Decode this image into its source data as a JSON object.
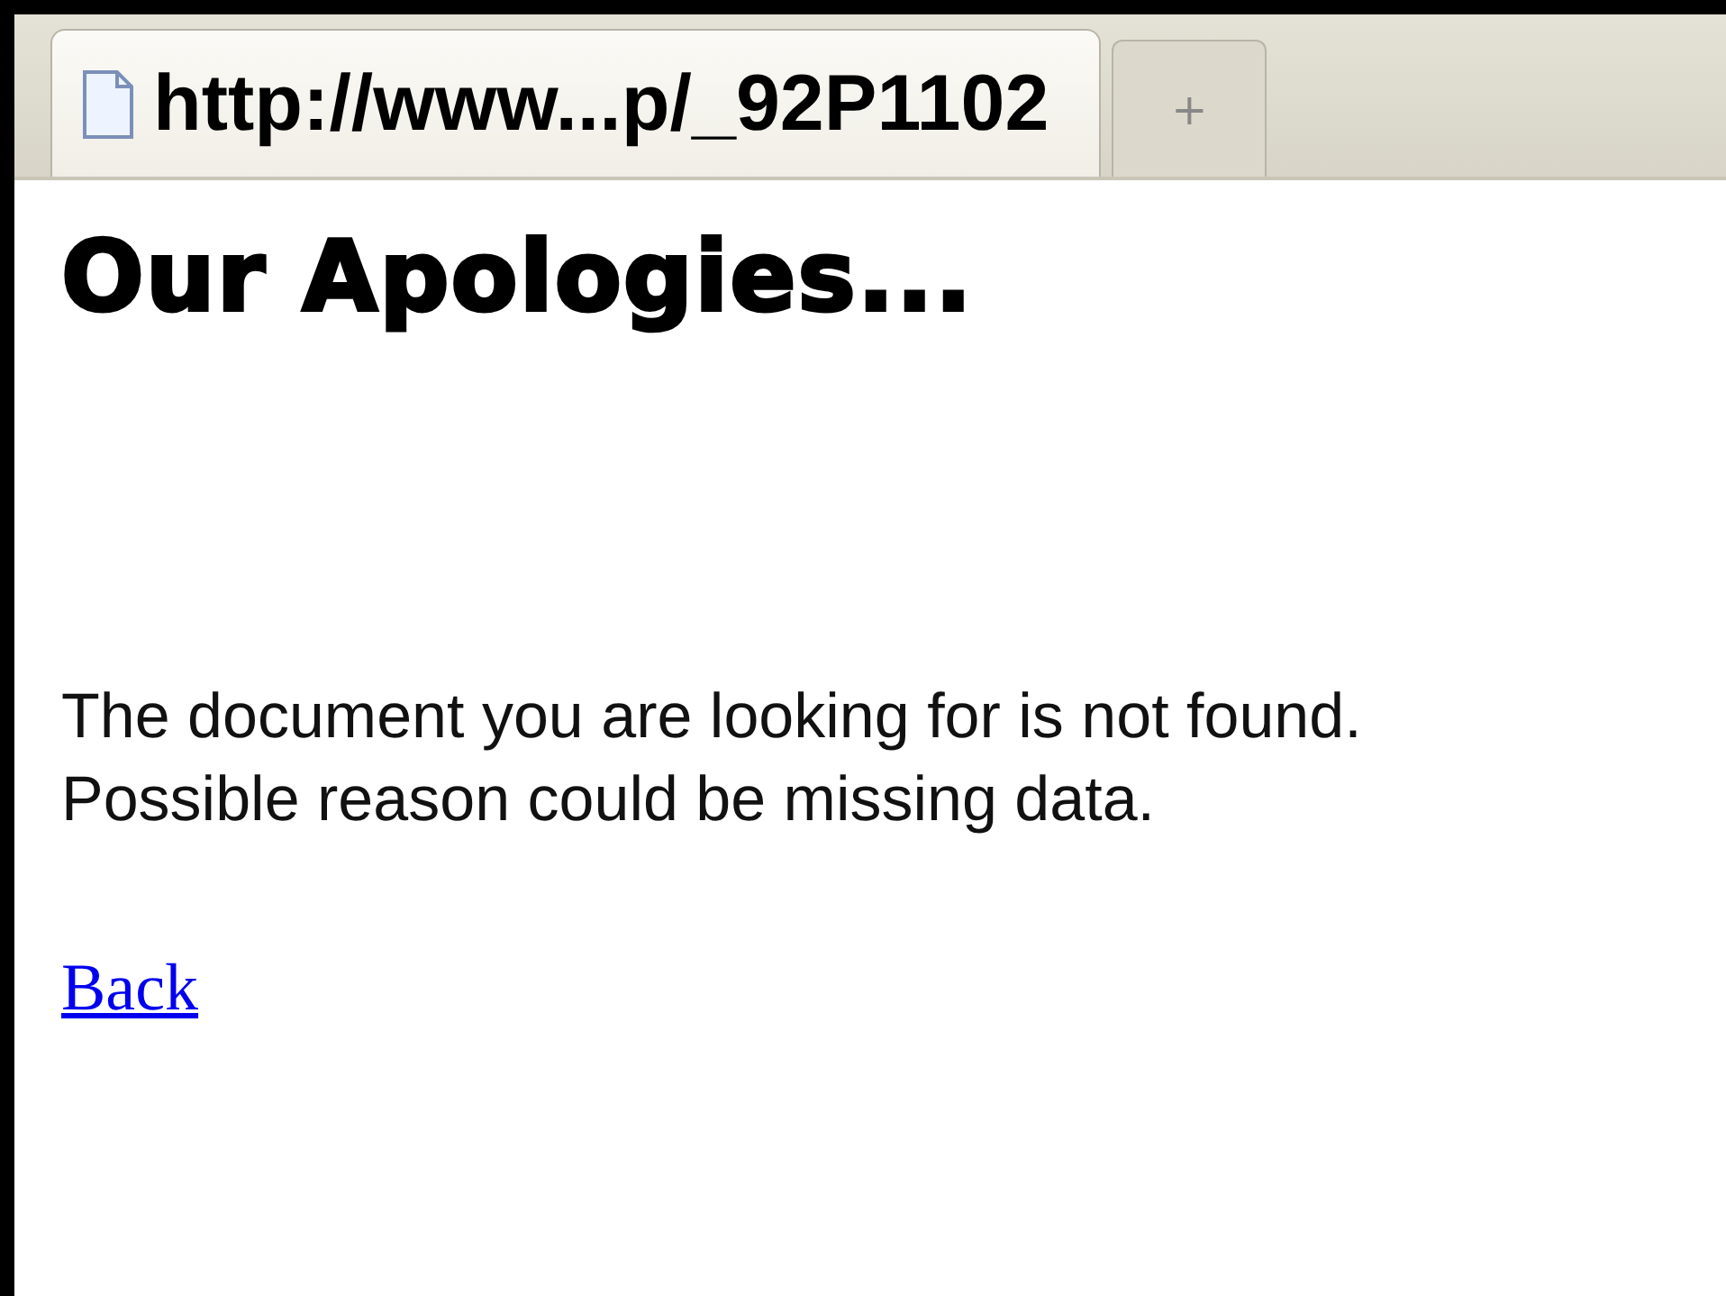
{
  "tabs": [
    {
      "title": "http://www...p/_92P1102",
      "selected": true
    }
  ],
  "new_tab": {
    "label": "+"
  },
  "page": {
    "heading": "Our Apologies...",
    "paragraph_lines": [
      "The document you are looking for is not found.",
      "Possible reason could be missing data."
    ],
    "link": "Back"
  }
}
